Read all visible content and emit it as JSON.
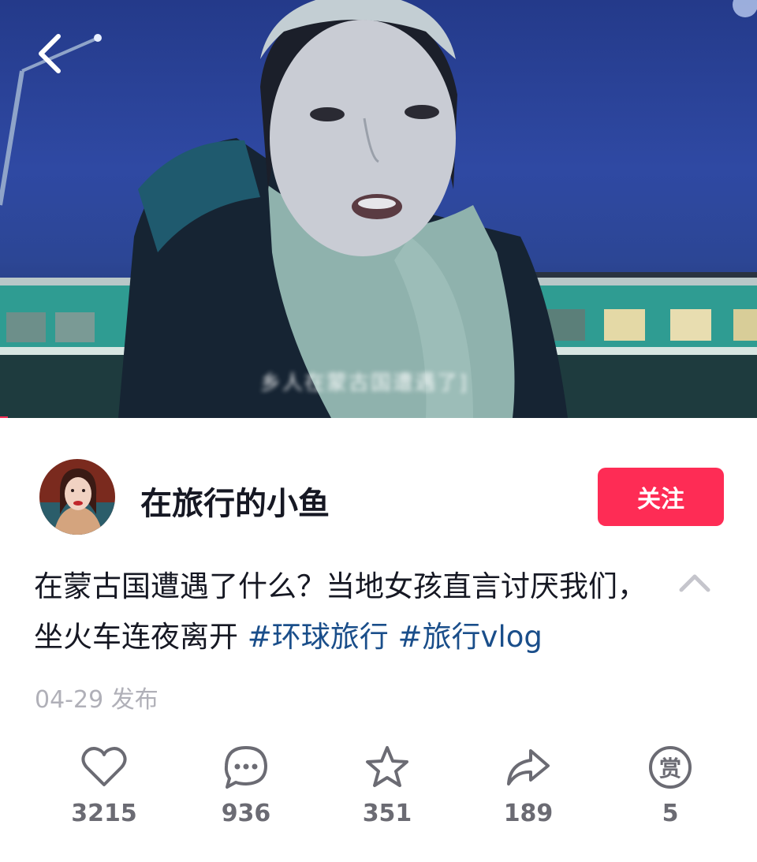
{
  "author": {
    "name": "在旅行的小鱼",
    "follow_label": "关注"
  },
  "post": {
    "description_text": "在蒙古国遭遇了什么？当地女孩直言讨厌我们，坐火车连夜离开",
    "hashtags": [
      "#环球旅行",
      "#旅行vlog"
    ],
    "date": "04-29",
    "date_suffix": "发布"
  },
  "video": {
    "subtitle": "乡人在蒙古国遭遇了]"
  },
  "actions": [
    {
      "name": "like",
      "icon": "heart-icon",
      "count": "3215"
    },
    {
      "name": "comment",
      "icon": "comment-icon",
      "count": "936"
    },
    {
      "name": "favorite",
      "icon": "star-icon",
      "count": "351"
    },
    {
      "name": "share",
      "icon": "share-icon",
      "count": "189"
    },
    {
      "name": "reward",
      "icon": "reward-icon",
      "glyph": "赏",
      "count": "5"
    }
  ],
  "colors": {
    "accent": "#fe2c55",
    "hashtag": "#1a4e8a",
    "muted": "#b0b0b8"
  }
}
